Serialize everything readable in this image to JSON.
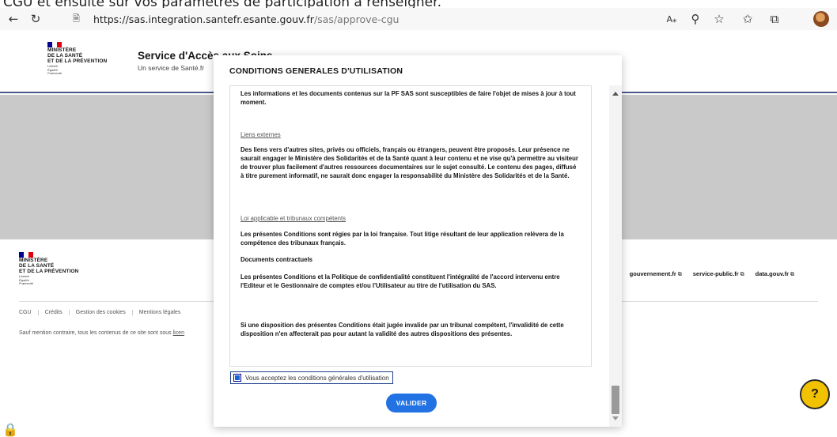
{
  "caption": "CGU et ensuite sur vos paramètres de participation à renseigner.",
  "browser": {
    "back_icon": "arrow-left-icon",
    "reload_icon": "reload-icon",
    "url_host": "https://sas.integration.santefr.esante.gouv.fr",
    "url_path": "/sas/approve-cgu"
  },
  "header": {
    "ministry_line1": "MINISTÈRE",
    "ministry_line2": "DE LA SANTÉ",
    "ministry_line3": "ET DE LA PRÉVENTION",
    "motto1": "Liberté",
    "motto2": "Égalité",
    "motto3": "Fraternité",
    "title": "Service d'Accès aux Soins",
    "subtitle": "Un service de Santé.fr"
  },
  "footer": {
    "ministry_line1": "MINISTÈRE",
    "ministry_line2": "DE LA SANTÉ",
    "ministry_line3": "ET DE LA PRÉVENTION",
    "motto1": "Liberté",
    "motto2": "Égalité",
    "motto3": "Fraternité",
    "external_links": [
      "gouvernement.fr",
      "service-public.fr",
      "data.gouv.fr"
    ],
    "bottom_links": [
      "CGU",
      "Crédits",
      "Gestion des cookies",
      "Mentions légales"
    ],
    "license_prefix": "Sauf mention contraire, tous les contenus de ce site sont sous ",
    "license_link": "licen"
  },
  "modal": {
    "title": "CONDITIONS GENERALES D'UTILISATION",
    "para_updates": "Les informations et les documents contenus sur la PF SAS sont susceptibles de faire l'objet de mises à jour à tout moment.",
    "heading_external": "Liens externes",
    "para_external": "Des liens vers d'autres sites, privés ou officiels, français ou étrangers, peuvent être proposés. Leur présence ne saurait engager le Ministère des Solidarités et de la Santé quant à leur contenu et ne vise qu'à permettre au visiteur de trouver plus facilement d'autres ressources documentaires sur le sujet consulté. Le contenu des pages, diffusé à titre purement informatif, ne saurait donc engager la responsabilité du Ministère des Solidarités et de la Santé.",
    "heading_law": "Loi applicable et tribunaux compétents",
    "para_law": "Les présentes Conditions sont régies par la loi française. Tout litige résultant de leur application relèvera de la compétence des tribunaux français.",
    "subheading_contract": "Documents contractuels",
    "para_contract": "Les présentes Conditions et la Politique de confidentialité constituent l'intégralité de l'accord intervenu entre l'Editeur et le Gestionnaire de comptes et/ou l'Utilisateur au titre de l'utilisation du SAS.",
    "para_invalid": "Si une disposition des présentes Conditions était jugée invalide par un tribunal compétent, l'invalidité de cette disposition n'en affecterait pas pour autant la validité des autres dispositions des présentes.",
    "accept_label": "Vous acceptez les conditions générales d'utilisation",
    "accept_checked": true,
    "validate_label": "VALIDER"
  },
  "help": {
    "label": "?"
  },
  "colors": {
    "primary_blue": "#2272e4",
    "help_yellow": "#f2c200",
    "marianne_blue": "#000091",
    "marianne_red": "#e1000f"
  }
}
